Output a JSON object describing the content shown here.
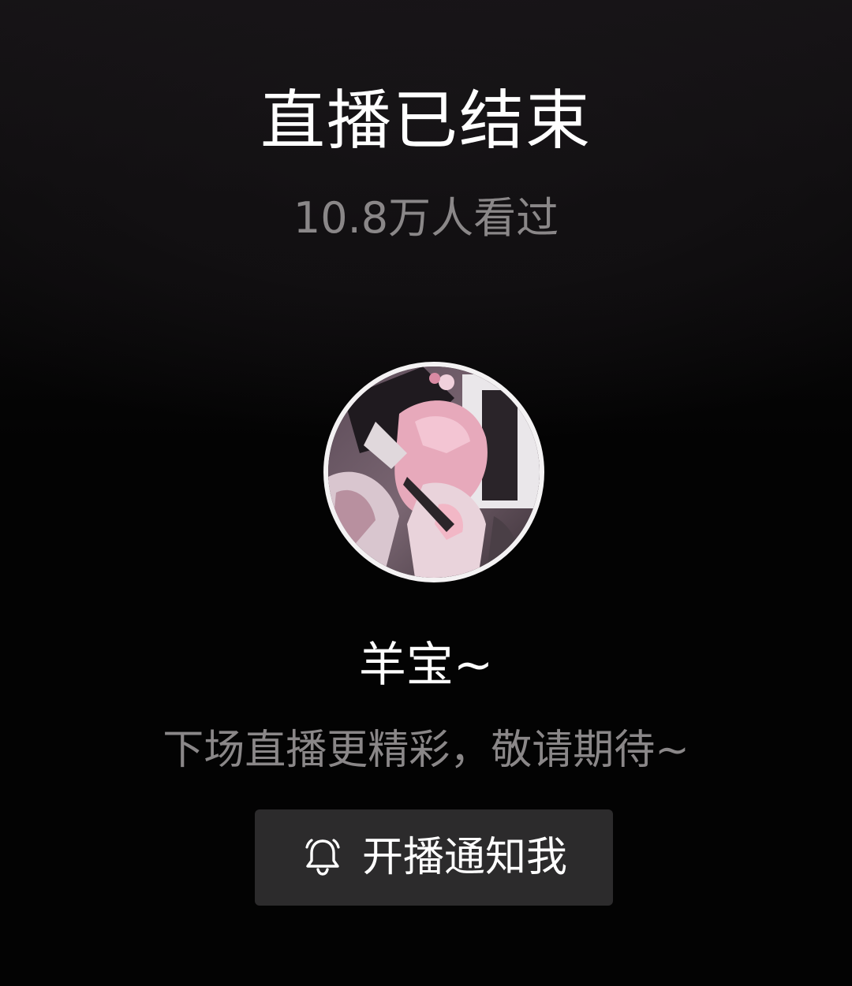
{
  "live_end": {
    "title": "直播已结束",
    "viewers": "10.8万人看过"
  },
  "streamer": {
    "avatar_icon": "streamer-avatar",
    "nickname": "羊宝~",
    "message": "下场直播更精彩，敬请期待~"
  },
  "notify": {
    "icon": "bell-icon",
    "label": "开播通知我"
  },
  "colors": {
    "background": "#030303",
    "primary_text": "#ffffff",
    "secondary_text": "#8a8788",
    "button_bg": "#2c2b2c"
  }
}
